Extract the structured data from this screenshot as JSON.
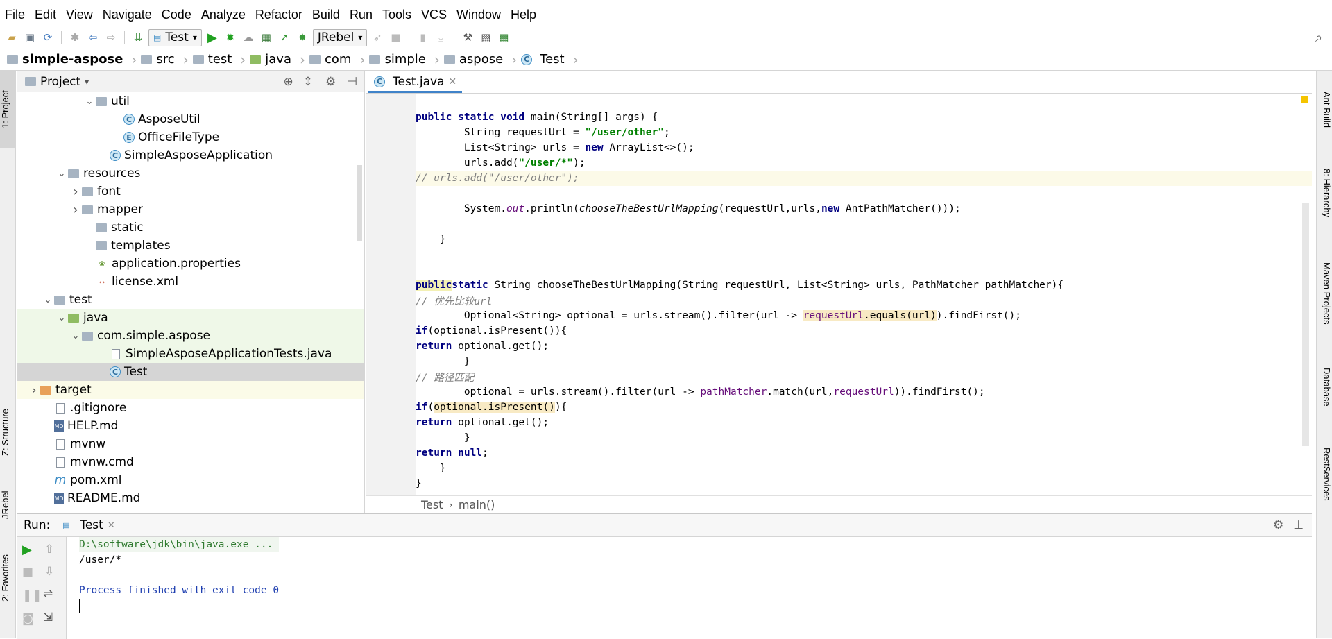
{
  "menu": [
    "File",
    "Edit",
    "View",
    "Navigate",
    "Code",
    "Analyze",
    "Refactor",
    "Build",
    "Run",
    "Tools",
    "VCS",
    "Window",
    "Help"
  ],
  "toolbar": {
    "run_config": "Test",
    "jrebel_config": "JRebel"
  },
  "breadcrumb": [
    "simple-aspose",
    "src",
    "test",
    "java",
    "com",
    "simple",
    "aspose",
    "Test"
  ],
  "left_tabs": {
    "project": "1: Project",
    "structure": "Z: Structure",
    "jrebel": "JRebel",
    "favorites": "2: Favorites"
  },
  "right_tabs": {
    "ant": "Ant Build",
    "hierarchy": "8: Hierarchy",
    "maven": "Maven Projects",
    "database": "Database",
    "rest": "RestServices"
  },
  "project": {
    "title": "Project",
    "tree": [
      {
        "label": "util",
        "indent": 5,
        "icon": "folder",
        "arrow": "down"
      },
      {
        "label": "AsposeUtil",
        "indent": 7,
        "icon": "class"
      },
      {
        "label": "OfficeFileType",
        "indent": 7,
        "icon": "enum"
      },
      {
        "label": "SimpleAsposeApplication",
        "indent": 6,
        "icon": "class-app"
      },
      {
        "label": "resources",
        "indent": 3,
        "icon": "folder",
        "arrow": "down"
      },
      {
        "label": "font",
        "indent": 4,
        "icon": "folder",
        "arrow": "right"
      },
      {
        "label": "mapper",
        "indent": 4,
        "icon": "folder",
        "arrow": "right"
      },
      {
        "label": "static",
        "indent": 5,
        "icon": "folder"
      },
      {
        "label": "templates",
        "indent": 5,
        "icon": "folder"
      },
      {
        "label": "application.properties",
        "indent": 5,
        "icon": "props"
      },
      {
        "label": "license.xml",
        "indent": 5,
        "icon": "xml"
      },
      {
        "label": "test",
        "indent": 2,
        "icon": "folder",
        "arrow": "down"
      },
      {
        "label": "java",
        "indent": 3,
        "icon": "folder-green",
        "arrow": "down",
        "row": "green"
      },
      {
        "label": "com.simple.aspose",
        "indent": 4,
        "icon": "folder",
        "arrow": "down",
        "row": "green"
      },
      {
        "label": "SimpleAsposeApplicationTests.java",
        "indent": 6,
        "icon": "file",
        "row": "green"
      },
      {
        "label": "Test",
        "indent": 6,
        "icon": "class",
        "row": "selected"
      },
      {
        "label": "target",
        "indent": 1,
        "icon": "folder-orange",
        "arrow": "right",
        "row": "yellow"
      },
      {
        "label": ".gitignore",
        "indent": 2,
        "icon": "file"
      },
      {
        "label": "HELP.md",
        "indent": 2,
        "icon": "md"
      },
      {
        "label": "mvnw",
        "indent": 2,
        "icon": "file"
      },
      {
        "label": "mvnw.cmd",
        "indent": 2,
        "icon": "file"
      },
      {
        "label": "pom.xml",
        "indent": 2,
        "icon": "maven"
      },
      {
        "label": "README.md",
        "indent": 2,
        "icon": "md"
      }
    ]
  },
  "editor": {
    "tab": "Test.java",
    "breadcrumb": [
      "Test",
      "main()"
    ]
  },
  "run": {
    "label": "Run:",
    "tab": "Test",
    "output": [
      "D:\\software\\jdk\\bin\\java.exe ...",
      "/user/*",
      "",
      "Process finished with exit code 0"
    ]
  }
}
